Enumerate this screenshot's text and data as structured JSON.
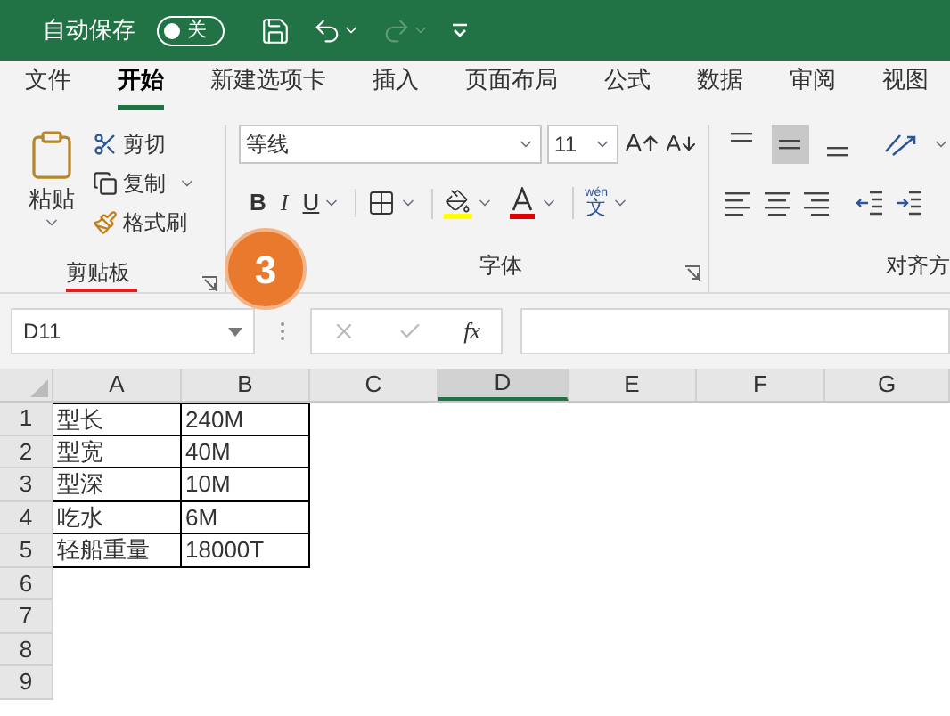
{
  "title_bar": {
    "autosave_label": "自动保存",
    "autosave_toggle": {
      "on": false,
      "label": "关"
    },
    "redo_enabled": false
  },
  "tabs": [
    {
      "label": "文件",
      "selected": false
    },
    {
      "label": "开始",
      "selected": true
    },
    {
      "label": "新建选项卡",
      "selected": false
    },
    {
      "label": "插入",
      "selected": false
    },
    {
      "label": "页面布局",
      "selected": false
    },
    {
      "label": "公式",
      "selected": false
    },
    {
      "label": "数据",
      "selected": false
    },
    {
      "label": "审阅",
      "selected": false
    },
    {
      "label": "视图",
      "selected": false
    }
  ],
  "ribbon": {
    "clipboard": {
      "paste": "粘贴",
      "cut": "剪切",
      "copy": "复制",
      "format_painter": "格式刷",
      "label": "剪贴板"
    },
    "font": {
      "font_name": "等线",
      "font_size": "11",
      "bold": "B",
      "italic": "I",
      "underline": "U",
      "phonetic_top": "wén",
      "phonetic_bottom": "文",
      "label": "字体"
    },
    "alignment": {
      "vertical_align": [
        {
          "selected": false
        },
        {
          "selected": true
        },
        {
          "selected": false
        }
      ],
      "label": "对齐方"
    }
  },
  "annotation": {
    "step": "3"
  },
  "formula_bar": {
    "name_box": "D11",
    "function_label": "fx"
  },
  "sheet": {
    "columns": [
      {
        "label": "A",
        "selected": false
      },
      {
        "label": "B",
        "selected": false
      },
      {
        "label": "C",
        "selected": false
      },
      {
        "label": "D",
        "selected": true
      },
      {
        "label": "E",
        "selected": false
      },
      {
        "label": "F",
        "selected": false
      },
      {
        "label": "G",
        "selected": false
      }
    ],
    "rows": [
      {
        "number": "1",
        "cells": [
          "型长",
          "240M"
        ]
      },
      {
        "number": "2",
        "cells": [
          "型宽",
          "40M"
        ]
      },
      {
        "number": "3",
        "cells": [
          "型深",
          "10M"
        ]
      },
      {
        "number": "4",
        "cells": [
          "吃水",
          "6M"
        ]
      },
      {
        "number": "5",
        "cells": [
          "轻船重量",
          "18000T"
        ]
      },
      {
        "number": "6"
      },
      {
        "number": "7"
      },
      {
        "number": "8"
      },
      {
        "number": "9"
      }
    ]
  }
}
